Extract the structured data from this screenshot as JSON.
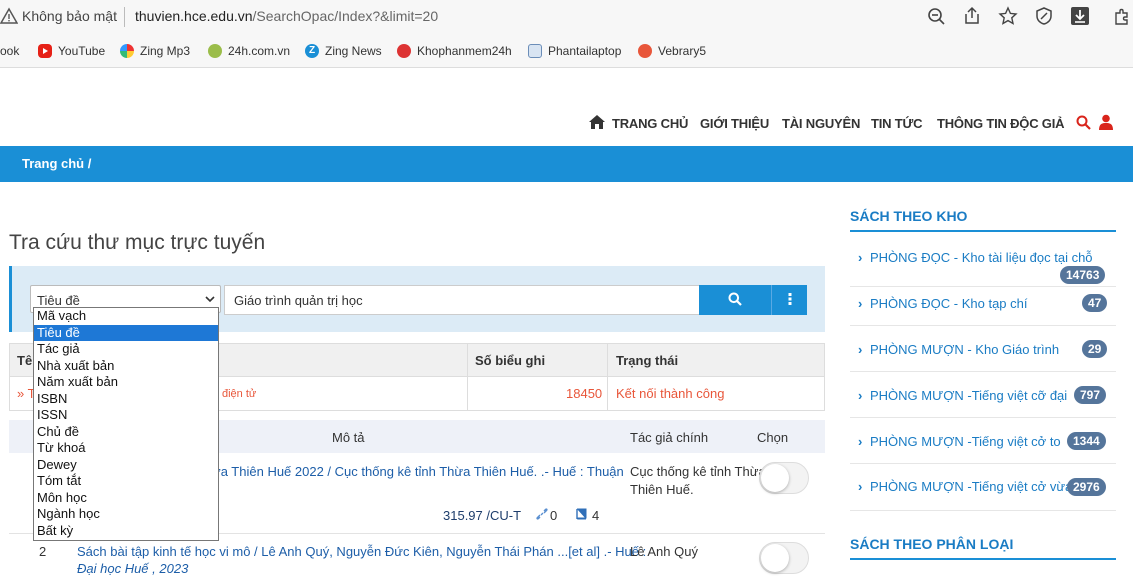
{
  "browser": {
    "not_secure": "Không bảo mật",
    "url_host": "thuvien.hce.edu.vn",
    "url_path": "/SearchOpac/Index?&limit=20",
    "bookmarks": [
      "ook",
      "YouTube",
      "Zing Mp3",
      "24h.com.vn",
      "Zing News",
      "Khophanmem24h",
      "Phantailaptop",
      "Vebrary5"
    ]
  },
  "nav": {
    "items": [
      "TRANG CHỦ",
      "GIỚI THIỆU",
      "TÀI NGUYÊN",
      "TIN TỨC",
      "THÔNG TIN ĐỘC GIẢ"
    ]
  },
  "breadcrumb": "Trang chủ  /",
  "page_title": "Tra cứu thư mục trực tuyến",
  "search": {
    "field_selected": "Tiêu đề",
    "query": "Giáo trình quản trị học",
    "options": [
      "Mã vạch",
      "Tiêu đề",
      "Tác giả",
      "Nhà xuất bản",
      "Năm xuất bản",
      "ISBN",
      "ISSN",
      "Chủ đề",
      "Từ khoá",
      "Dewey",
      "Tóm tắt",
      "Môn học",
      "Ngành học",
      "Bất kỳ"
    ],
    "selected_index": 1
  },
  "db_table": {
    "headers": [
      "Tê",
      "Số biểu ghi",
      "Trạng thái"
    ],
    "row": {
      "prefix": "» T",
      "name_tail": "điện tử",
      "count": "18450",
      "status": "Kết nối thành công"
    }
  },
  "results": {
    "headers": {
      "desc": "Mô tả",
      "author": "Tác giả chính",
      "choose": "Chọn"
    },
    "items": [
      {
        "desc": "ừa Thiên Huế 2022 / Cục thống kê tỉnh Thừa Thiên Huế. .- Huế : Thuận",
        "author_line1": "Cục thống kê tỉnh Thừa",
        "author_line2": "Thiên Huế.",
        "call_number": "315.97 /CU-T",
        "links_count": "0",
        "books_count": "4"
      },
      {
        "num": "2",
        "desc_line1": "Sách bài tập kinh tế học vi mô / Lê Anh Quý, Nguyễn Đức Kiên, Nguyễn Thái Phán ...[et al] .- Huế :",
        "desc_line2": "Đại học Huế , 2023",
        "author_line1": "Lê Anh Quý"
      }
    ]
  },
  "sidebar": {
    "section1_title": "SÁCH THEO KHO",
    "section2_title": "SÁCH THEO PHÂN LOẠI",
    "items": [
      {
        "label": "PHÒNG ĐỌC - Kho tài liệu đọc tại chỗ",
        "count": "14763"
      },
      {
        "label": "PHÒNG ĐỌC - Kho tạp chí",
        "count": "47"
      },
      {
        "label": "PHÒNG MƯỢN - Kho Giáo trình",
        "count": "29"
      },
      {
        "label": "PHÒNG MƯỢN -Tiếng việt cỡ đại",
        "count": "797"
      },
      {
        "label": "PHÒNG MƯỢN -Tiếng việt cở to",
        "count": "1344"
      },
      {
        "label": "PHÒNG MƯỢN -Tiếng việt cở vừa",
        "count": "2976"
      }
    ]
  },
  "colors": {
    "accent": "#1a8fd6",
    "badge": "#55759b",
    "success": "#e8563a"
  }
}
